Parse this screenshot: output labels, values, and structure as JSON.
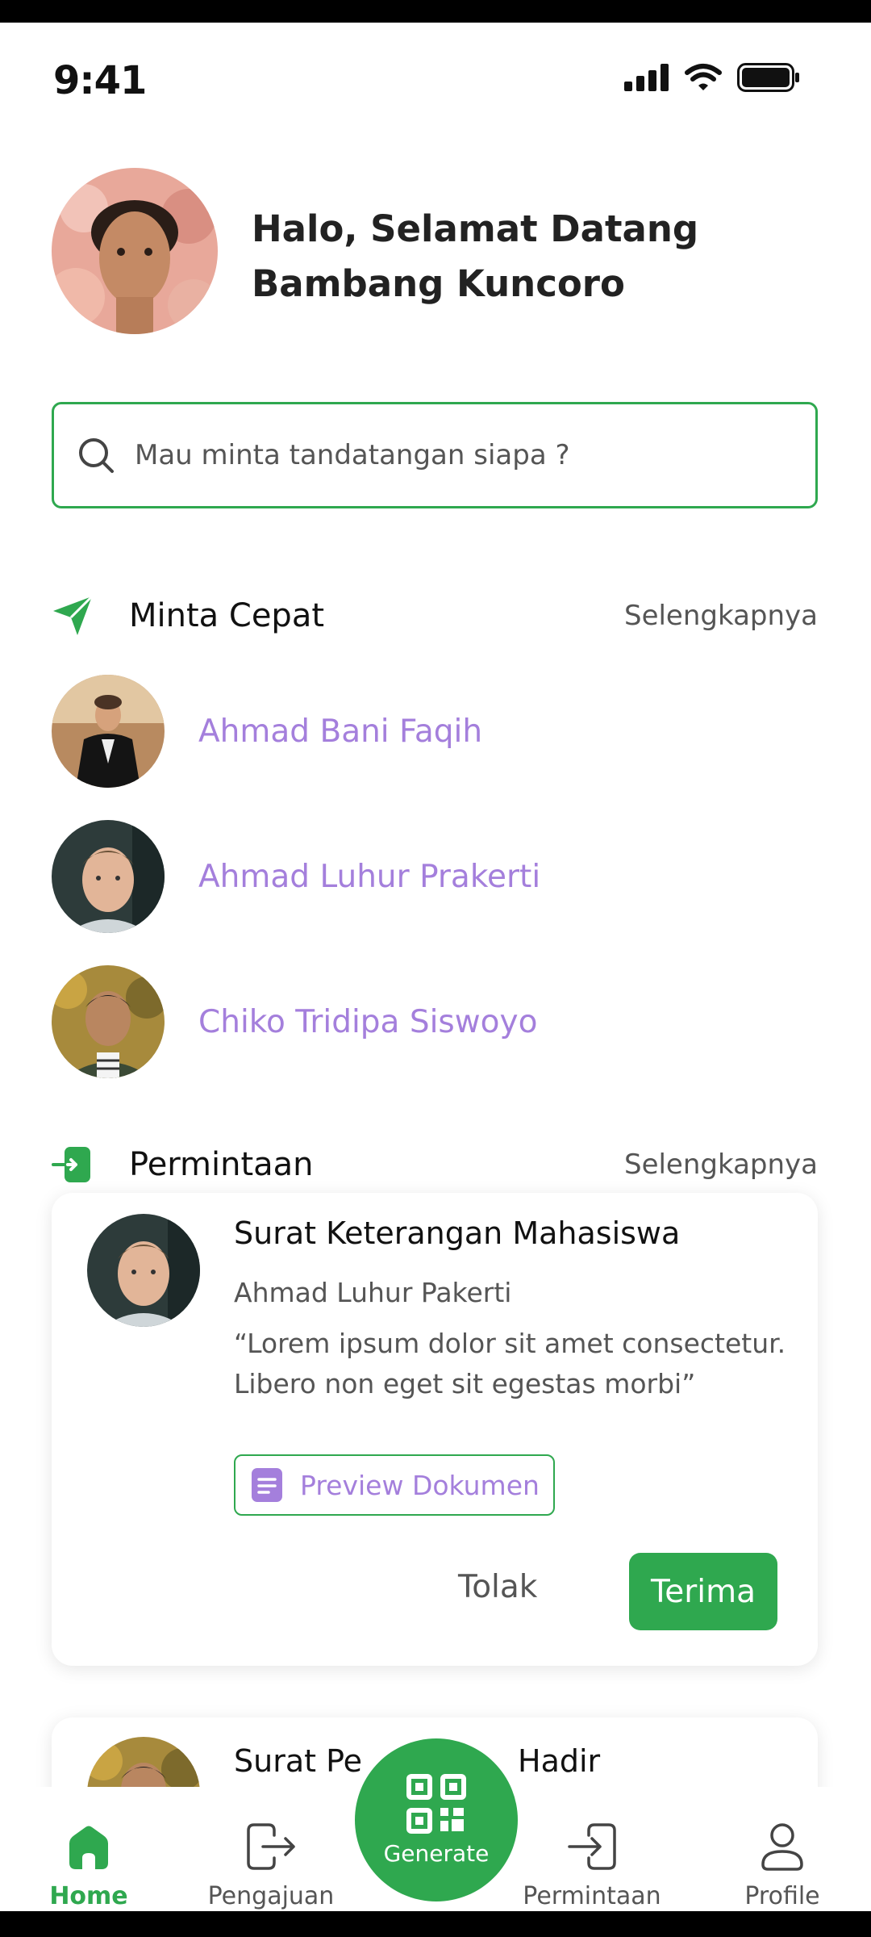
{
  "status_bar": {
    "time": "9:41"
  },
  "header": {
    "greeting_line1": "Halo, Selamat Datang",
    "greeting_line2": "Bambang Kuncoro"
  },
  "search": {
    "placeholder": "Mau minta tandatangan siapa ?"
  },
  "quick_section": {
    "title": "Minta Cepat",
    "more": "Selengkapnya",
    "items": [
      {
        "name": "Ahmad Bani Faqih"
      },
      {
        "name": "Ahmad Luhur Prakerti"
      },
      {
        "name": "Chiko Tridipa Siswoyo"
      }
    ]
  },
  "request_section": {
    "title": "Permintaan",
    "more": "Selengkapnya",
    "cards": [
      {
        "title": "Surat Keterangan Mahasiswa",
        "sender": "Ahmad Luhur Pakerti",
        "note": "“Lorem ipsum dolor sit amet consectetur. Libero non eget sit egestas morbi”",
        "preview_label": "Preview Dokumen",
        "reject_label": "Tolak",
        "accept_label": "Terima"
      },
      {
        "title_left": "Surat Pe",
        "title_right": "Hadir"
      }
    ]
  },
  "bottom_nav": {
    "items": [
      {
        "label": "Home",
        "icon": "home-icon",
        "active": true
      },
      {
        "label": "Pengajuan",
        "icon": "logout-icon"
      },
      {
        "label": "Permintaan",
        "icon": "login-icon"
      },
      {
        "label": "Profile",
        "icon": "user-icon"
      }
    ],
    "generate_label": "Generate"
  },
  "colors": {
    "primary": "#2fa84f",
    "accent_purple": "#a47fdc",
    "text": "#111111",
    "muted": "#555555"
  }
}
